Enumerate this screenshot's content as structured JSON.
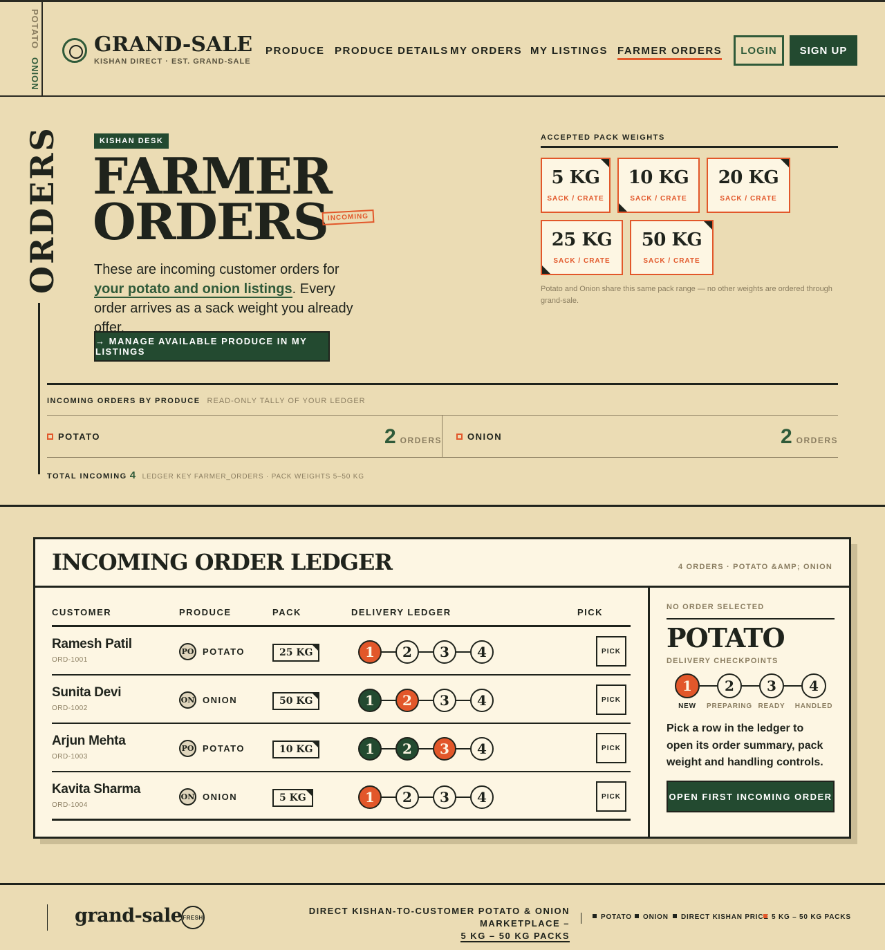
{
  "header": {
    "side_labels": [
      "POTATO",
      "ONION"
    ],
    "brand": "GRAND-SALE",
    "brand_sub": "KISHAN DIRECT · EST. GRAND-SALE",
    "nav": [
      "PRODUCE",
      "PRODUCE DETAILS",
      "MY ORDERS",
      "MY LISTINGS",
      "FARMER ORDERS"
    ],
    "active_nav": "FARMER ORDERS",
    "login": "LOGIN",
    "signup": "SIGN UP"
  },
  "hero": {
    "vertical_label": "ORDERS",
    "tag": "KISHAN DESK",
    "title_line1": "FARMER",
    "title_line2": "ORDERS",
    "stamp": "INCOMING",
    "desc_before": "These are incoming customer orders for ",
    "desc_link": "your potato and onion listings",
    "desc_after": ". Every order arrives as a sack weight you already offer.",
    "manage_button": "→  MANAGE AVAILABLE PRODUCE IN MY LISTINGS"
  },
  "pack_weights": {
    "title": "ACCEPTED PACK WEIGHTS",
    "cards": [
      {
        "kg": "5 KG",
        "sub": "SACK / CRATE"
      },
      {
        "kg": "10 KG",
        "sub": "SACK / CRATE"
      },
      {
        "kg": "20 KG",
        "sub": "SACK / CRATE"
      },
      {
        "kg": "25 KG",
        "sub": "SACK / CRATE"
      },
      {
        "kg": "50 KG",
        "sub": "SACK / CRATE"
      }
    ],
    "note": "Potato and Onion share this same pack range — no other weights are ordered through grand-sale."
  },
  "tally": {
    "title": "INCOMING ORDERS BY PRODUCE",
    "subtitle": "READ-ONLY TALLY OF YOUR LEDGER",
    "items": [
      {
        "name": "POTATO",
        "count": "2",
        "unit": "ORDERS"
      },
      {
        "name": "ONION",
        "count": "2",
        "unit": "ORDERS"
      }
    ],
    "total_label": "TOTAL INCOMING",
    "total": "4",
    "key": "LEDGER KEY FARMER_ORDERS · PACK WEIGHTS 5–50 KG"
  },
  "ledger": {
    "title": "INCOMING ORDER LEDGER",
    "meta": "4 ORDERS · POTATO &AMP; ONION",
    "columns": [
      "CUSTOMER",
      "PRODUCE",
      "PACK",
      "DELIVERY LEDGER",
      "PICK"
    ],
    "rows": [
      {
        "customer": "Ramesh Patil",
        "id": "ORD-1001",
        "badge": "PO",
        "produce": "POTATO",
        "pack": "25 KG",
        "stage": 1,
        "pick": "PICK"
      },
      {
        "customer": "Sunita Devi",
        "id": "ORD-1002",
        "badge": "ON",
        "produce": "ONION",
        "pack": "50 KG",
        "stage": 2,
        "pick": "PICK"
      },
      {
        "customer": "Arjun Mehta",
        "id": "ORD-1003",
        "badge": "PO",
        "produce": "POTATO",
        "pack": "10 KG",
        "stage": 3,
        "pick": "PICK"
      },
      {
        "customer": "Kavita Sharma",
        "id": "ORD-1004",
        "badge": "ON",
        "produce": "ONION",
        "pack": "5 KG",
        "stage": 1,
        "pick": "PICK"
      }
    ],
    "step_numbers": [
      "1",
      "2",
      "3",
      "4"
    ]
  },
  "detail": {
    "status": "NO ORDER SELECTED",
    "name": "POTATO",
    "checkpoints_label": "DELIVERY CHECKPOINTS",
    "checkpoints": [
      "NEW",
      "PREPARING",
      "READY",
      "HANDLED"
    ],
    "current_checkpoint": 1,
    "text": "Pick a row in the ledger to open its order summary, pack weight and handling controls.",
    "button": "OPEN FIRST INCOMING ORDER"
  },
  "footer": {
    "brand": "grand-sale",
    "badge": "FRESH",
    "tagline_1": "DIRECT KISHAN-TO-CUSTOMER POTATO & ONION MARKETPLACE –",
    "tagline_2": "5 KG – 50 KG PACKS",
    "tags": [
      "POTATO",
      "ONION",
      "DIRECT KISHAN PRICE",
      "5 KG – 50 KG PACKS"
    ]
  },
  "colors": {
    "background": "#ebdcb4",
    "green": "#234a30",
    "orange": "#e2572a",
    "ink": "#1f231c",
    "paper": "#fdf6e3"
  }
}
